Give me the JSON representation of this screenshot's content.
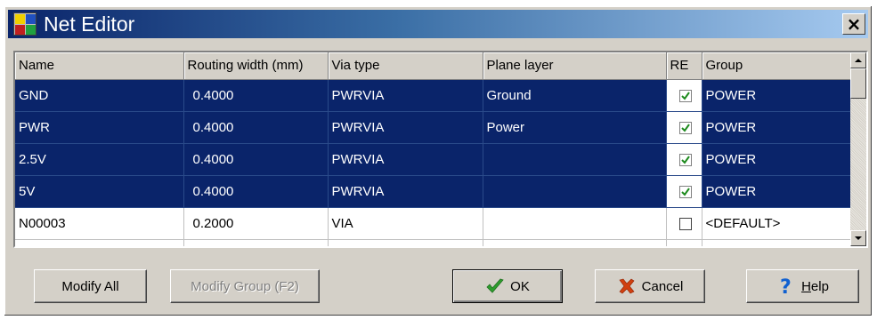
{
  "window": {
    "title": "Net Editor",
    "close_label": "×"
  },
  "grid": {
    "columns": [
      "Name",
      "Routing width (mm)",
      "Via type",
      "Plane layer",
      "RE",
      "Group"
    ],
    "rows": [
      {
        "name": "GND",
        "width": "0.4000",
        "via": "PWRVIA",
        "plane": "Ground",
        "re": true,
        "group": "POWER",
        "selected": true
      },
      {
        "name": "PWR",
        "width": "0.4000",
        "via": "PWRVIA",
        "plane": "Power",
        "re": true,
        "group": "POWER",
        "selected": true
      },
      {
        "name": "2.5V",
        "width": "0.4000",
        "via": "PWRVIA",
        "plane": "",
        "re": true,
        "group": "POWER",
        "selected": true
      },
      {
        "name": "5V",
        "width": "0.4000",
        "via": "PWRVIA",
        "plane": "",
        "re": true,
        "group": "POWER",
        "selected": true
      },
      {
        "name": "N00003",
        "width": "0.2000",
        "via": "VIA",
        "plane": "",
        "re": false,
        "group": "<DEFAULT>",
        "selected": false
      }
    ]
  },
  "buttons": {
    "modify_all": "Modify All",
    "modify_group": "Modify Group (F2)",
    "ok": "OK",
    "cancel": "Cancel",
    "help_prefix": "",
    "help_underlined": "H",
    "help_rest": "elp"
  },
  "colors": {
    "selection": "#0a246a",
    "dialog_face": "#d4d0c8",
    "ok_check": "#2e9e2e",
    "cancel_x": "#d04010",
    "help_q": "#1060d0"
  }
}
